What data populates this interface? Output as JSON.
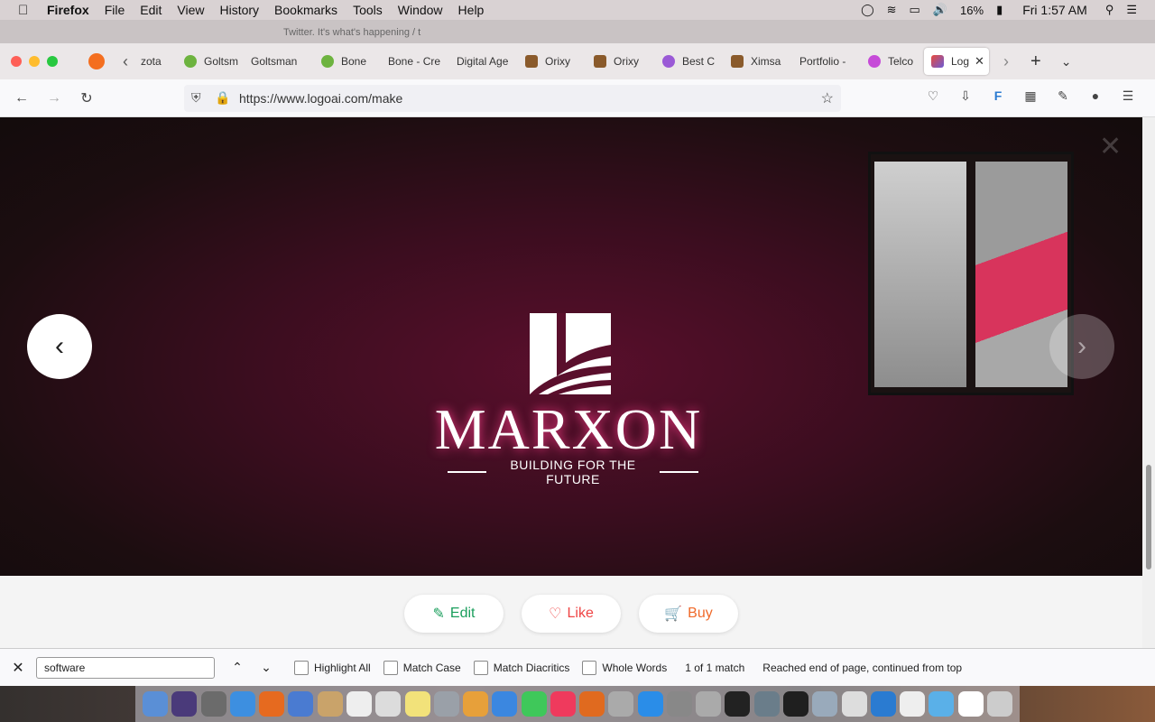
{
  "menubar": {
    "app": "Firefox",
    "items": [
      "File",
      "Edit",
      "View",
      "History",
      "Bookmarks",
      "Tools",
      "Window",
      "Help"
    ],
    "battery": "16%",
    "clock": "Fri 1:57 AM"
  },
  "ghost_tabs": [
    "Twitter. It's what's happening / t"
  ],
  "tabs": [
    {
      "label": "zota",
      "color": "#ffffff"
    },
    {
      "label": "Goltsm",
      "color": "#6db33f"
    },
    {
      "label": "Goltsman",
      "color": "#ffffff"
    },
    {
      "label": "Bone",
      "color": "#6db33f"
    },
    {
      "label": "Bone - Cre",
      "color": "#ffffff"
    },
    {
      "label": "Digital Age",
      "color": "#ffffff"
    },
    {
      "label": "Orixy",
      "color": "#8a5a2b"
    },
    {
      "label": "Orixy",
      "color": "#8a5a2b"
    },
    {
      "label": "Best C",
      "color": "#9a5ad6"
    },
    {
      "label": "Ximsa",
      "color": "#8a5a2b"
    },
    {
      "label": "Portfolio -",
      "color": "#ffffff"
    },
    {
      "label": "Telco",
      "color": "#c64bd8"
    },
    {
      "label": "Log",
      "color": "#e94b3c",
      "active": true
    }
  ],
  "url": "https://www.logoai.com/make",
  "logo": {
    "name": "MARXON",
    "tagline": "BUILDING FOR THE FUTURE"
  },
  "actions": {
    "edit": "Edit",
    "like": "Like",
    "buy": "Buy"
  },
  "colors": {
    "edit": "#1a9e5c",
    "like": "#ef4444",
    "buy": "#f06a2a"
  },
  "findbar": {
    "query": "software",
    "highlight_all": "Highlight All",
    "match_case": "Match Case",
    "match_diacritics": "Match Diacritics",
    "whole_words": "Whole Words",
    "count": "1 of 1 match",
    "status": "Reached end of page, continued from top"
  },
  "dock_colors": [
    "#5a8fd6",
    "#4a3a7a",
    "#6b6b6b",
    "#3d8fe0",
    "#e66a1f",
    "#4a7bd1",
    "#c9a36a",
    "#eee",
    "#dcdcdc",
    "#f2e27a",
    "#9aa0a8",
    "#e7a03a",
    "#3b87e0",
    "#3fc85a",
    "#ef3a5d",
    "#e06a1f",
    "#aaaaaa",
    "#2a8de8",
    "#888888",
    "#aaaaaa",
    "#222222",
    "#6a7d8a",
    "#1f1f1f",
    "#9ab",
    "#ddd",
    "#2a7bd1",
    "#eeeeee",
    "#5ab0e8",
    "#ffffff",
    "#cccccc"
  ]
}
